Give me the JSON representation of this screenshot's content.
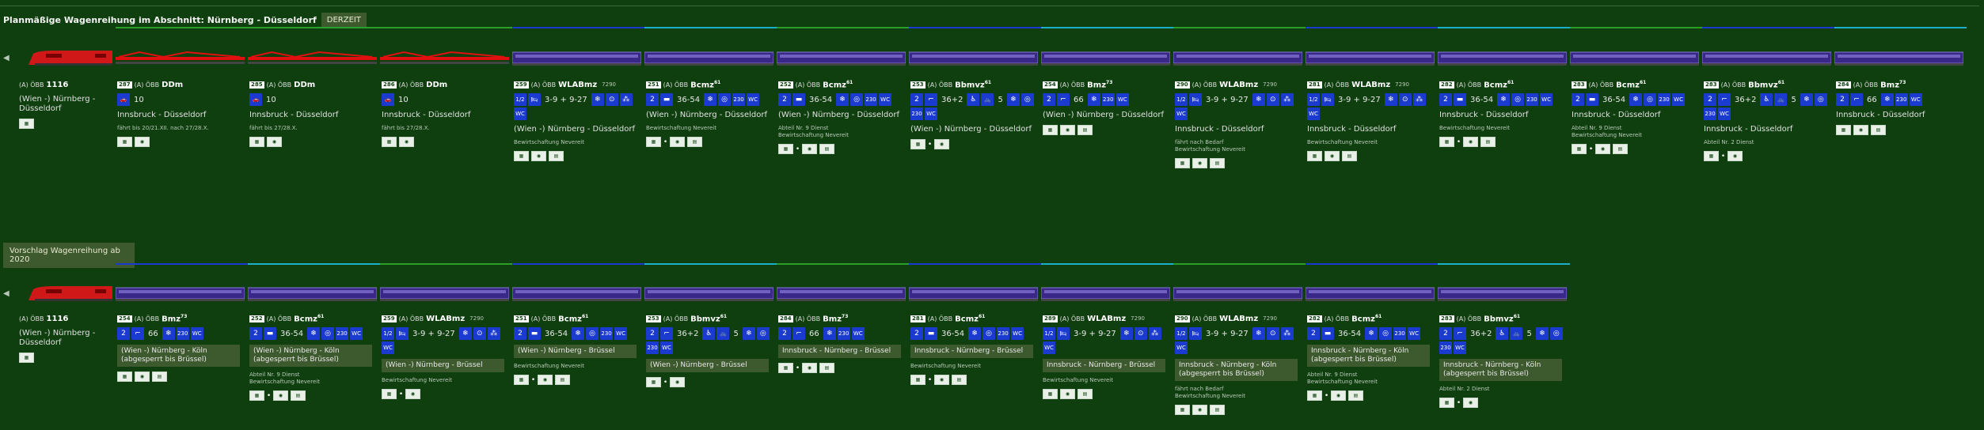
{
  "header": {
    "title": "Planmäßige Wagenreihung im Abschnitt: Nürnberg - Düsseldorf",
    "tag": "DERZEIT"
  },
  "section2": {
    "title": "Vorschlag Wagenreihung ab 2020"
  },
  "colors": {
    "background": "#0f3f0f",
    "loco": "#d01818",
    "autotrain": "#e01010",
    "sleeper": "#3a2888",
    "icon_blue": "#1a3ad0",
    "rail_green": "#2aa02a",
    "rail_blue": "#1a3ad0",
    "rail_cyan": "#1ab0c8"
  },
  "train1": {
    "loco": {
      "prefix": "(A) ÖBB",
      "class": "1116",
      "route": "(Wien -) Nürnberg - Düsseldorf"
    },
    "cars": [
      {
        "num": "287",
        "prefix": "(A) ÖBB",
        "cls": "DDm",
        "sup": "",
        "ann": "",
        "icons": [
          "car-icon"
        ],
        "count": "10",
        "route": "Innsbruck - Düsseldorf",
        "note": "fährt bis 20/21.XII. nach 27/28.X.",
        "footer": [
          "a",
          "b"
        ],
        "color": "#e01010"
      },
      {
        "num": "285",
        "prefix": "(A) ÖBB",
        "cls": "DDm",
        "sup": "",
        "ann": "",
        "icons": [
          "car-icon"
        ],
        "count": "10",
        "route": "Innsbruck - Düsseldorf",
        "note": "fährt bis 27/28.X.",
        "footer": [
          "a",
          "b"
        ],
        "color": "#e01010"
      },
      {
        "num": "286",
        "prefix": "(A) ÖBB",
        "cls": "DDm",
        "sup": "",
        "ann": "",
        "icons": [
          "car-icon"
        ],
        "count": "10",
        "route": "Innsbruck - Düsseldorf",
        "note": "fährt bis 27/28.X.",
        "footer": [
          "a",
          "b"
        ],
        "color": "#e01010"
      },
      {
        "num": "259",
        "prefix": "(A) ÖBB",
        "cls": "WLABmz",
        "sup": "",
        "ann": "7290",
        "icons": [
          "class-icon",
          "bed-icon"
        ],
        "count": "3-9 + 9-27",
        "icons2": [
          "snow-icon",
          "towel-icon",
          "shower-icon",
          "wc-icon"
        ],
        "route": "(Wien -) Nürnberg - Düsseldorf",
        "note": "Bewirtschaftung Nevereit",
        "footer": [
          "a",
          "b",
          "c"
        ],
        "color": "#3a2888"
      },
      {
        "num": "251",
        "prefix": "(A) ÖBB",
        "cls": "Bcmz",
        "sup": "61",
        "ann": "",
        "icons": [
          "class2-icon",
          "couchette-icon"
        ],
        "count": "36-54",
        "icons2": [
          "snow-icon",
          "plug-icon",
          "socket-icon",
          "wc-icon"
        ],
        "route": "(Wien -) Nürnberg - Düsseldorf",
        "note": "Bewirtschaftung Nevereit",
        "footer": [
          "a",
          "dot",
          "b",
          "c"
        ],
        "color": "#3a2888"
      },
      {
        "num": "252",
        "prefix": "(A) ÖBB",
        "cls": "Bcmz",
        "sup": "61",
        "ann": "",
        "icons": [
          "class2-icon",
          "couchette-icon"
        ],
        "count": "36-54",
        "icons2": [
          "snow-icon",
          "plug-icon",
          "socket-icon",
          "wc-icon"
        ],
        "route": "(Wien -) Nürnberg - Düsseldorf",
        "note": "Abteil Nr. 9 Dienst\nBewirtschaftung Nevereit",
        "footer": [
          "a",
          "dot",
          "b",
          "c"
        ],
        "color": "#3a2888"
      },
      {
        "num": "253",
        "prefix": "(A) ÖBB",
        "cls": "Bbmvz",
        "sup": "61",
        "ann": "",
        "icons": [
          "class2-icon",
          "seat-icon"
        ],
        "count": "36+2",
        "icons2": [
          "wheelchair-icon",
          "bike-icon",
          "count5",
          "snow-icon",
          "plug-icon",
          "socket-icon",
          "wc-icon"
        ],
        "route": "(Wien -) Nürnberg - Düsseldorf",
        "note": "",
        "footer": [
          "a",
          "dot",
          "b"
        ],
        "color": "#3a2888"
      },
      {
        "num": "254",
        "prefix": "(A) ÖBB",
        "cls": "Bmz",
        "sup": "73",
        "ann": "",
        "icons": [
          "class2-icon",
          "seat-icon"
        ],
        "count": "66",
        "icons2": [
          "snow-icon",
          "socket-icon",
          "wc-icon"
        ],
        "route": "(Wien -) Nürnberg - Düsseldorf",
        "note": "",
        "footer": [
          "a",
          "b",
          "c"
        ],
        "color": "#3a2888"
      },
      {
        "num": "290",
        "prefix": "(A) ÖBB",
        "cls": "WLABmz",
        "sup": "",
        "ann": "7290",
        "icons": [
          "class-icon",
          "bed-icon"
        ],
        "count": "3-9 + 9-27",
        "icons2": [
          "snow-icon",
          "towel-icon",
          "shower-icon",
          "wc-icon"
        ],
        "route": "Innsbruck - Düsseldorf",
        "note": "fährt nach Bedarf\nBewirtschaftung Nevereit",
        "footer": [
          "a",
          "b",
          "c"
        ],
        "color": "#3a2888"
      },
      {
        "num": "281",
        "prefix": "(A) ÖBB",
        "cls": "WLABmz",
        "sup": "",
        "ann": "7290",
        "icons": [
          "class-icon",
          "bed-icon"
        ],
        "count": "3-9 + 9-27",
        "icons2": [
          "snow-icon",
          "towel-icon",
          "shower-icon",
          "wc-icon"
        ],
        "route": "Innsbruck - Düsseldorf",
        "note": "Bewirtschaftung Nevereit",
        "footer": [
          "a",
          "b",
          "c"
        ],
        "color": "#3a2888"
      },
      {
        "num": "282",
        "prefix": "(A) ÖBB",
        "cls": "Bcmz",
        "sup": "61",
        "ann": "",
        "icons": [
          "class2-icon",
          "couchette-icon"
        ],
        "count": "36-54",
        "icons2": [
          "snow-icon",
          "plug-icon",
          "socket-icon",
          "wc-icon"
        ],
        "route": "Innsbruck - Düsseldorf",
        "note": "Bewirtschaftung Nevereit",
        "footer": [
          "a",
          "dot",
          "b",
          "c"
        ],
        "color": "#3a2888"
      },
      {
        "num": "283",
        "prefix": "(A) ÖBB",
        "cls": "Bcmz",
        "sup": "61",
        "ann": "",
        "icons": [
          "class2-icon",
          "couchette-icon"
        ],
        "count": "36-54",
        "icons2": [
          "snow-icon",
          "plug-icon",
          "socket-icon",
          "wc-icon"
        ],
        "route": "Innsbruck - Düsseldorf",
        "note": "Abteil Nr. 9 Dienst\nBewirtschaftung Nevereit",
        "footer": [
          "a",
          "dot",
          "b",
          "c"
        ],
        "color": "#3a2888"
      },
      {
        "num": "283",
        "prefix": "(A) ÖBB",
        "cls": "Bbmvz",
        "sup": "61",
        "ann": "",
        "icons": [
          "class2-icon",
          "seat-icon"
        ],
        "count": "36+2",
        "icons2": [
          "wheelchair-icon",
          "bike-icon",
          "count5",
          "snow-icon",
          "plug-icon",
          "socket-icon",
          "wc-icon"
        ],
        "route": "Innsbruck - Düsseldorf",
        "note": "Abteil Nr. 2 Dienst",
        "footer": [
          "a",
          "dot",
          "b"
        ],
        "color": "#3a2888"
      },
      {
        "num": "284",
        "prefix": "(A) ÖBB",
        "cls": "Bmz",
        "sup": "73",
        "ann": "",
        "icons": [
          "class2-icon",
          "seat-icon"
        ],
        "count": "66",
        "icons2": [
          "snow-icon",
          "socket-icon",
          "wc-icon"
        ],
        "route": "Innsbruck - Düsseldorf",
        "note": "",
        "footer": [
          "a",
          "b",
          "c"
        ],
        "color": "#3a2888"
      }
    ]
  },
  "train2": {
    "loco": {
      "prefix": "(A) ÖBB",
      "class": "1116",
      "route": "(Wien -) Nürnberg - Düsseldorf"
    },
    "cars": [
      {
        "num": "254",
        "prefix": "(A) ÖBB",
        "cls": "Bmz",
        "sup": "73",
        "ann": "",
        "icons": [
          "class2-icon",
          "seat-icon"
        ],
        "count": "66",
        "icons2": [
          "snow-icon",
          "socket-icon",
          "wc-icon"
        ],
        "route": "(Wien -) Nürnberg - Köln\n(abgesperrt bis Brüssel)",
        "boxed": true,
        "note": "",
        "footer": [
          "a",
          "b",
          "c"
        ],
        "color": "#3a2888"
      },
      {
        "num": "252",
        "prefix": "(A) ÖBB",
        "cls": "Bcmz",
        "sup": "61",
        "ann": "",
        "icons": [
          "class2-icon",
          "couchette-icon"
        ],
        "count": "36-54",
        "icons2": [
          "snow-icon",
          "plug-icon",
          "socket-icon",
          "wc-icon"
        ],
        "route": "(Wien -) Nürnberg - Köln\n(abgesperrt bis Brüssel)",
        "boxed": true,
        "note": "Abteil Nr. 9 Dienst\nBewirtschaftung Nevereit",
        "footer": [
          "a",
          "dot",
          "b",
          "c"
        ],
        "color": "#3a2888"
      },
      {
        "num": "259",
        "prefix": "(A) ÖBB",
        "cls": "WLABmz",
        "sup": "",
        "ann": "7290",
        "icons": [
          "class-icon",
          "bed-icon"
        ],
        "count": "3-9 + 9-27",
        "icons2": [
          "snow-icon",
          "towel-icon",
          "shower-icon",
          "wc-icon"
        ],
        "route": "(Wien -) Nürnberg - Brüssel",
        "boxed": true,
        "note": "Bewirtschaftung Nevereit",
        "footer": [
          "a",
          "dot",
          "b"
        ],
        "color": "#3a2888"
      },
      {
        "num": "251",
        "prefix": "(A) ÖBB",
        "cls": "Bcmz",
        "sup": "61",
        "ann": "",
        "icons": [
          "class2-icon",
          "couchette-icon"
        ],
        "count": "36-54",
        "icons2": [
          "snow-icon",
          "plug-icon",
          "socket-icon",
          "wc-icon"
        ],
        "route": "(Wien -) Nürnberg - Brüssel",
        "boxed": true,
        "note": "Bewirtschaftung Nevereit",
        "footer": [
          "a",
          "dot",
          "b",
          "c"
        ],
        "color": "#3a2888"
      },
      {
        "num": "253",
        "prefix": "(A) ÖBB",
        "cls": "Bbmvz",
        "sup": "61",
        "ann": "",
        "icons": [
          "class2-icon",
          "seat-icon"
        ],
        "count": "36+2",
        "icons2": [
          "wheelchair-icon",
          "bike-icon",
          "count5",
          "snow-icon",
          "plug-icon",
          "socket-icon",
          "wc-icon"
        ],
        "route": "(Wien -) Nürnberg - Brüssel",
        "boxed": true,
        "note": "",
        "footer": [
          "a",
          "dot",
          "b"
        ],
        "color": "#3a2888"
      },
      {
        "num": "284",
        "prefix": "(A) ÖBB",
        "cls": "Bmz",
        "sup": "73",
        "ann": "",
        "icons": [
          "class2-icon",
          "seat-icon"
        ],
        "count": "66",
        "icons2": [
          "snow-icon",
          "socket-icon",
          "wc-icon"
        ],
        "route": "Innsbruck - Nürnberg - Brüssel",
        "boxed": true,
        "note": "",
        "footer": [
          "a",
          "dot",
          "b",
          "c"
        ],
        "color": "#3a2888"
      },
      {
        "num": "281",
        "prefix": "(A) ÖBB",
        "cls": "Bcmz",
        "sup": "61",
        "ann": "",
        "icons": [
          "class2-icon",
          "couchette-icon"
        ],
        "count": "36-54",
        "icons2": [
          "snow-icon",
          "plug-icon",
          "socket-icon",
          "wc-icon"
        ],
        "route": "Innsbruck - Nürnberg - Brüssel",
        "boxed": true,
        "note": "Bewirtschaftung Nevereit",
        "footer": [
          "a",
          "dot",
          "b",
          "c"
        ],
        "color": "#3a2888"
      },
      {
        "num": "289",
        "prefix": "(A) ÖBB",
        "cls": "WLABmz",
        "sup": "",
        "ann": "7290",
        "icons": [
          "class-icon",
          "bed-icon"
        ],
        "count": "3-9 + 9-27",
        "icons2": [
          "snow-icon",
          "towel-icon",
          "shower-icon",
          "wc-icon"
        ],
        "route": "Innsbruck - Nürnberg - Brüssel",
        "boxed": true,
        "note": "Bewirtschaftung Nevereit",
        "footer": [
          "a",
          "b",
          "c"
        ],
        "color": "#3a2888"
      },
      {
        "num": "290",
        "prefix": "(A) ÖBB",
        "cls": "WLABmz",
        "sup": "",
        "ann": "7290",
        "icons": [
          "class-icon",
          "bed-icon"
        ],
        "count": "3-9 + 9-27",
        "icons2": [
          "snow-icon",
          "towel-icon",
          "shower-icon",
          "wc-icon"
        ],
        "route": "Innsbruck - Nürnberg - Köln\n(abgesperrt bis Brüssel)",
        "boxed": true,
        "note": "fährt nach Bedarf\nBewirtschaftung Nevereit",
        "footer": [
          "a",
          "b",
          "c"
        ],
        "color": "#3a2888"
      },
      {
        "num": "282",
        "prefix": "(A) ÖBB",
        "cls": "Bcmz",
        "sup": "61",
        "ann": "",
        "icons": [
          "class2-icon",
          "couchette-icon"
        ],
        "count": "36-54",
        "icons2": [
          "snow-icon",
          "plug-icon",
          "socket-icon",
          "wc-icon"
        ],
        "route": "Innsbruck - Nürnberg - Köln\n(abgesperrt bis Brüssel)",
        "boxed": true,
        "note": "Abteil Nr. 9 Dienst\nBewirtschaftung Nevereit",
        "footer": [
          "a",
          "dot",
          "b",
          "c"
        ],
        "color": "#3a2888"
      },
      {
        "num": "283",
        "prefix": "(A) ÖBB",
        "cls": "Bbmvz",
        "sup": "61",
        "ann": "",
        "icons": [
          "class2-icon",
          "seat-icon"
        ],
        "count": "36+2",
        "icons2": [
          "wheelchair-icon",
          "bike-icon",
          "count5",
          "snow-icon",
          "plug-icon",
          "socket-icon",
          "wc-icon"
        ],
        "route": "Innsbruck - Nürnberg - Köln\n(abgesperrt bis Brüssel)",
        "boxed": true,
        "note": "Abteil Nr. 2 Dienst",
        "footer": [
          "a",
          "dot",
          "b"
        ],
        "color": "#3a2888"
      }
    ]
  }
}
